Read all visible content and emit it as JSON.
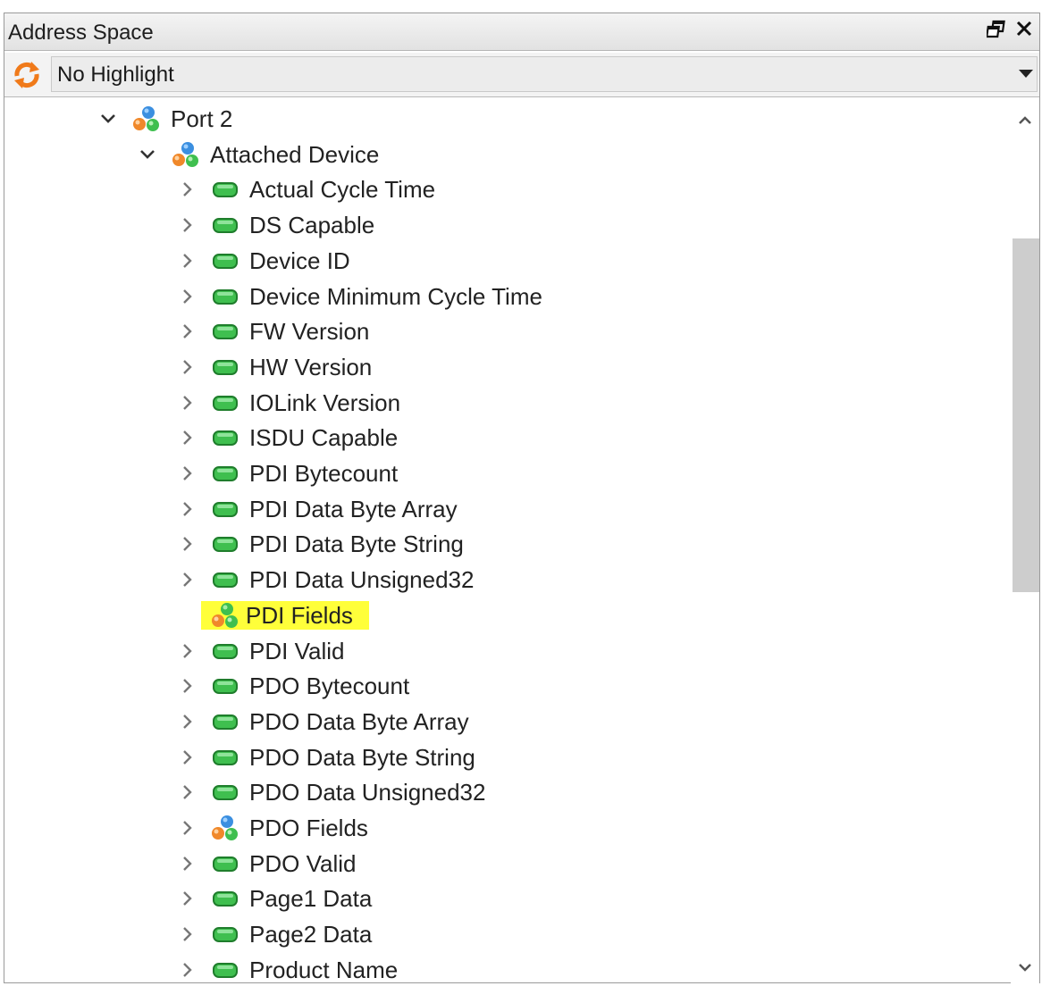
{
  "window": {
    "title": "Address Space",
    "restore_icon": "restore-window-icon",
    "close_icon": "close-icon"
  },
  "toolbar": {
    "refresh_icon": "refresh-icon",
    "highlight_value": "No Highlight",
    "dropdown_icon": "dropdown-arrow-icon"
  },
  "tree": {
    "items": [
      {
        "label": "Port 2",
        "level": 0,
        "expanded": true,
        "icon": "folder-object-icon"
      },
      {
        "label": "Attached Device",
        "level": 1,
        "expanded": true,
        "icon": "folder-object-icon"
      },
      {
        "label": "Actual Cycle Time",
        "level": 2,
        "expanded": false,
        "icon": "variable-icon"
      },
      {
        "label": "DS Capable",
        "level": 2,
        "expanded": false,
        "icon": "variable-icon"
      },
      {
        "label": "Device ID",
        "level": 2,
        "expanded": false,
        "icon": "variable-icon"
      },
      {
        "label": "Device Minimum Cycle Time",
        "level": 2,
        "expanded": false,
        "icon": "variable-icon"
      },
      {
        "label": "FW Version",
        "level": 2,
        "expanded": false,
        "icon": "variable-icon"
      },
      {
        "label": "HW Version",
        "level": 2,
        "expanded": false,
        "icon": "variable-icon"
      },
      {
        "label": "IOLink Version",
        "level": 2,
        "expanded": false,
        "icon": "variable-icon"
      },
      {
        "label": "ISDU Capable",
        "level": 2,
        "expanded": false,
        "icon": "variable-icon"
      },
      {
        "label": "PDI Bytecount",
        "level": 2,
        "expanded": false,
        "icon": "variable-icon"
      },
      {
        "label": "PDI Data Byte Array",
        "level": 2,
        "expanded": false,
        "icon": "variable-icon"
      },
      {
        "label": "PDI Data Byte String",
        "level": 2,
        "expanded": false,
        "icon": "variable-icon"
      },
      {
        "label": "PDI Data Unsigned32",
        "level": 2,
        "expanded": false,
        "icon": "variable-icon"
      },
      {
        "label": "PDI Fields",
        "level": 2,
        "expanded": null,
        "icon": "folder-object-green-icon",
        "highlighted": true
      },
      {
        "label": "PDI Valid",
        "level": 2,
        "expanded": false,
        "icon": "variable-icon"
      },
      {
        "label": "PDO Bytecount",
        "level": 2,
        "expanded": false,
        "icon": "variable-icon"
      },
      {
        "label": "PDO Data Byte Array",
        "level": 2,
        "expanded": false,
        "icon": "variable-icon"
      },
      {
        "label": "PDO Data Byte String",
        "level": 2,
        "expanded": false,
        "icon": "variable-icon"
      },
      {
        "label": "PDO Data Unsigned32",
        "level": 2,
        "expanded": false,
        "icon": "variable-icon"
      },
      {
        "label": "PDO Fields",
        "level": 2,
        "expanded": false,
        "icon": "folder-object-icon"
      },
      {
        "label": "PDO Valid",
        "level": 2,
        "expanded": false,
        "icon": "variable-icon"
      },
      {
        "label": "Page1 Data",
        "level": 2,
        "expanded": false,
        "icon": "variable-icon"
      },
      {
        "label": "Page2 Data",
        "level": 2,
        "expanded": false,
        "icon": "variable-icon"
      },
      {
        "label": "Product Name",
        "level": 2,
        "expanded": false,
        "icon": "variable-icon"
      }
    ]
  },
  "colors": {
    "highlight": "#ffff3a",
    "variable_green": "#3fbf4f",
    "refresh_orange": "#f07a1a"
  },
  "scrollbar": {
    "up_icon": "scroll-up-icon",
    "down_icon": "scroll-down-icon"
  }
}
